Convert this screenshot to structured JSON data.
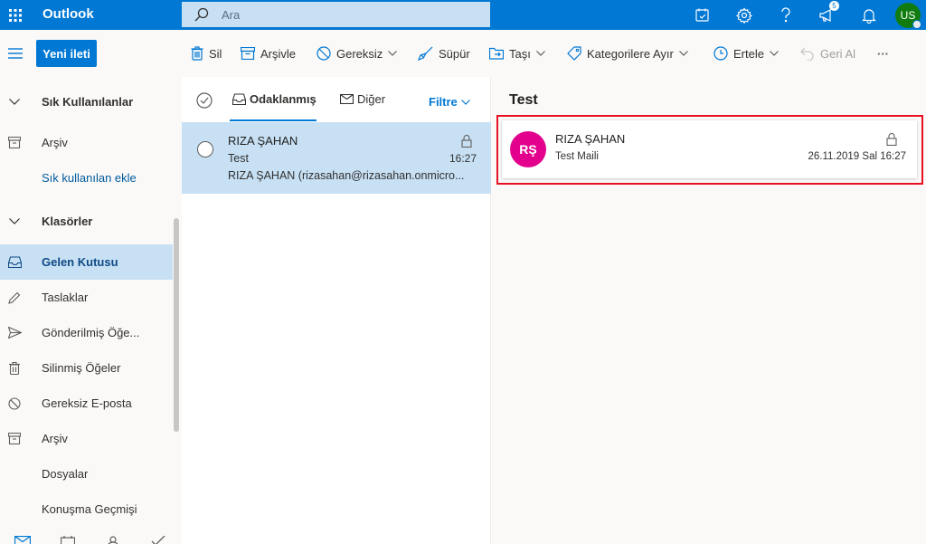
{
  "app": {
    "name": "Outlook"
  },
  "search": {
    "placeholder": "Ara"
  },
  "topbar": {
    "notification_count": "5",
    "user_initials": "US"
  },
  "toolbar": {
    "new_message": "Yeni ileti",
    "delete": "Sil",
    "archive": "Arşivle",
    "junk": "Gereksiz",
    "sweep": "Süpür",
    "move": "Taşı",
    "categorize": "Kategorilere Ayır",
    "snooze": "Ertele",
    "undo": "Geri Al",
    "more": "···"
  },
  "sidebar": {
    "favorites_header": "Sık Kullanılanlar",
    "favorites": [
      {
        "label": "Arşiv"
      },
      {
        "label": "Sık kullanılan ekle"
      }
    ],
    "folders_header": "Klasörler",
    "folders": [
      {
        "label": "Gelen Kutusu",
        "active": true
      },
      {
        "label": "Taslaklar"
      },
      {
        "label": "Gönderilmiş Öğe..."
      },
      {
        "label": "Silinmiş Öğeler"
      },
      {
        "label": "Gereksiz E-posta"
      },
      {
        "label": "Arşiv"
      },
      {
        "label": "Dosyalar"
      },
      {
        "label": "Konuşma Geçmişi"
      }
    ]
  },
  "message_list": {
    "tabs": [
      {
        "label": "Odaklanmış",
        "active": true
      },
      {
        "label": "Diğer"
      }
    ],
    "filter": "Filtre",
    "messages": [
      {
        "sender": "RIZA ŞAHAN",
        "subject": "Test",
        "preview": "RIZA ŞAHAN (rizasahan@rizasahan.onmicro...",
        "time": "16:27",
        "selected": true
      }
    ]
  },
  "reading_pane": {
    "title": "Test",
    "message": {
      "avatar_initials": "RŞ",
      "sender": "RIZA ŞAHAN",
      "to": "Test Maili",
      "date": "26.11.2019 Sal 16:27"
    }
  },
  "colors": {
    "brand": "#0078d4",
    "selected_row": "#c7e0f4",
    "avatar": "#e3008c",
    "highlight_border": "#e81123"
  }
}
